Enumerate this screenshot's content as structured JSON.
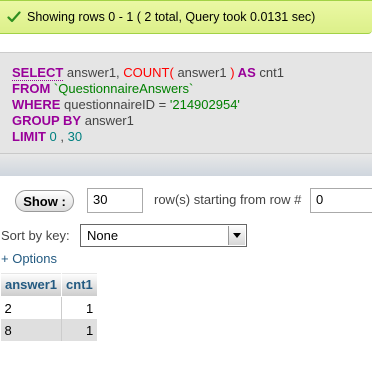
{
  "banner": {
    "message": "Showing rows 0 - 1 ( 2 total, Query took 0.0131 sec)",
    "icon": "check-icon",
    "color": "#dcf08a"
  },
  "sql": {
    "l1_kw": "SELECT",
    "l1_a": " answer1, ",
    "l1_fn": "COUNT(",
    "l1_b": " answer1 ",
    "l1_fn2": ")",
    "l1_kw2": " AS",
    "l1_c": " cnt1",
    "l2_kw": "FROM",
    "l2_a": " `QuestionnaireAnswers`",
    "l3_kw": "WHERE",
    "l3_a": " questionnaireID = ",
    "l3_str": "'214902954'",
    "l4_kw": "GROUP BY",
    "l4_a": " answer1",
    "l5_kw": "LIMIT",
    "l5_n1": " 0",
    "l5_sep": " , ",
    "l5_n2": "30"
  },
  "nav": {
    "show_label": "Show :",
    "rows_value": "30",
    "rows_label": "row(s) starting from row #",
    "start_value": "0"
  },
  "sort": {
    "label": "Sort by key:",
    "selected": "None"
  },
  "options_link": "+ Options",
  "table": {
    "headers": [
      "answer1",
      "cnt1"
    ],
    "rows": [
      [
        "2",
        "1"
      ],
      [
        "8",
        "1"
      ]
    ]
  }
}
